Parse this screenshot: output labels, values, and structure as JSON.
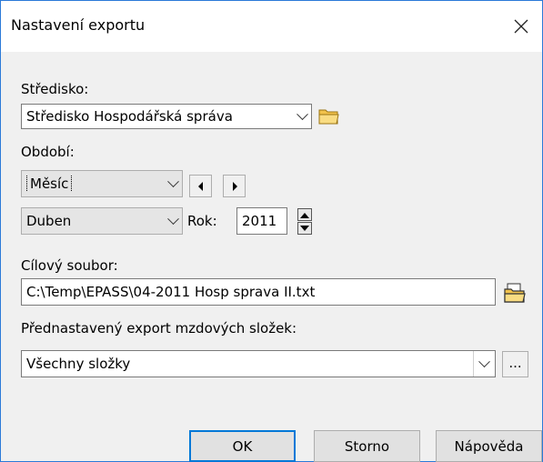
{
  "window": {
    "title": "Nastavení exportu"
  },
  "center": {
    "label": "Středisko:",
    "value": "Středisko Hospodářská správa"
  },
  "period": {
    "label": "Období:",
    "type_value": "Měsíc",
    "month_value": "Duben",
    "year_label": "Rok:",
    "year_value": "2011"
  },
  "target_file": {
    "label": "Cílový soubor:",
    "value": "C:\\Temp\\EPASS\\04-2011 Hosp sprava II.txt"
  },
  "preset": {
    "label": "Přednastavený export mzdových složek:",
    "value": "Všechny složky",
    "more_label": "..."
  },
  "buttons": {
    "ok": "OK",
    "cancel": "Storno",
    "help": "Nápověda"
  },
  "colors": {
    "accent": "#0078d7",
    "folder": "#f2c24b"
  }
}
